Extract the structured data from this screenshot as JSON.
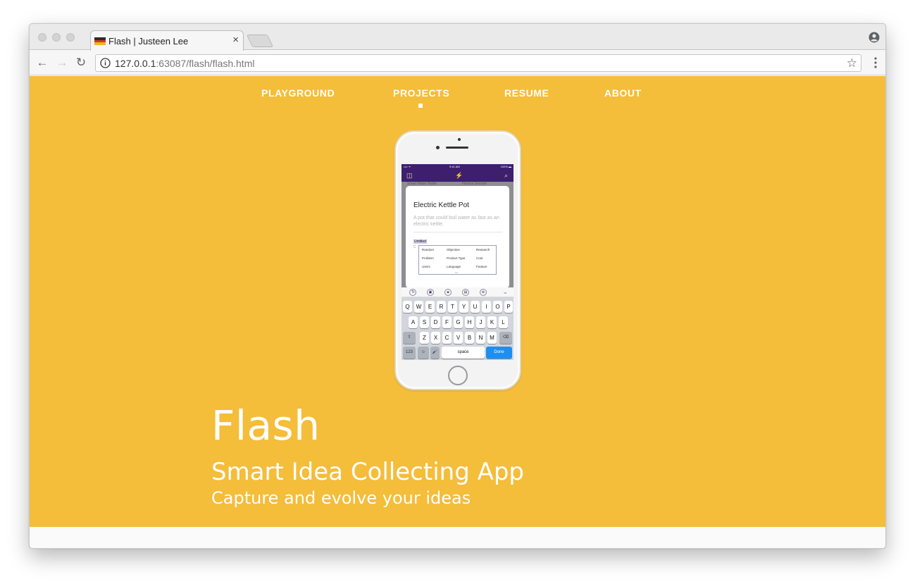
{
  "browser": {
    "tab_title": "Flash | Justeen Lee",
    "close_glyph": "×",
    "url_host": "127.0.0.1",
    "url_rest": ":63087/flash/flash.html",
    "back_glyph": "←",
    "forward_glyph": "→",
    "reload_glyph": "↻",
    "star_glyph": "☆",
    "favicon_colors": [
      "#2b2b2b",
      "#d8342a",
      "#f2b41f"
    ]
  },
  "page": {
    "background_color": "#f4bd3a",
    "nav": {
      "items": [
        {
          "label": "PLAYGROUND"
        },
        {
          "label": "PROJECTS",
          "active": true
        },
        {
          "label": "RESUME"
        },
        {
          "label": "ABOUT"
        }
      ]
    },
    "hero": {
      "title": "Flash",
      "subtitle": "Smart Idea Collecting App",
      "tagline": "Capture and evolve your ideas"
    }
  },
  "phone": {
    "status": {
      "carrier": "•••• ᯤ",
      "time": "9:41 AM",
      "battery": "100% ▬"
    },
    "app_bar": {
      "left_icon": "◫",
      "center_icon": "⚡",
      "right_icon": "⌕"
    },
    "behind_text": [
      "Smart Water Bottle",
      "Fitness Session"
    ],
    "card": {
      "title": "Electric Kettle Pot",
      "description": "A pot that could boil water as fast as an electric kettle.",
      "untitled": "Untitled",
      "small": "C",
      "popup": [
        "Random",
        "Objective",
        "Research",
        "Problem",
        "Product Type",
        "Cost",
        "Users",
        "Language",
        "Feature"
      ],
      "popup_more": "•••"
    },
    "format_bar": {
      "icons": [
        "Tt",
        "▣",
        "◈",
        "▤",
        "⊕"
      ],
      "chevron": "⌄"
    },
    "keyboard": {
      "row1": [
        "Q",
        "W",
        "E",
        "R",
        "T",
        "Y",
        "U",
        "I",
        "O",
        "P"
      ],
      "row2": [
        "A",
        "S",
        "D",
        "F",
        "G",
        "H",
        "J",
        "K",
        "L"
      ],
      "row3": [
        "Z",
        "X",
        "C",
        "V",
        "B",
        "N",
        "M"
      ],
      "shift": "⇧",
      "delete": "⌫",
      "numbers": "123",
      "emoji": "☺",
      "mic": "🎤",
      "space": "space",
      "done": "Done"
    },
    "accent_color": "#3d1f6e"
  }
}
